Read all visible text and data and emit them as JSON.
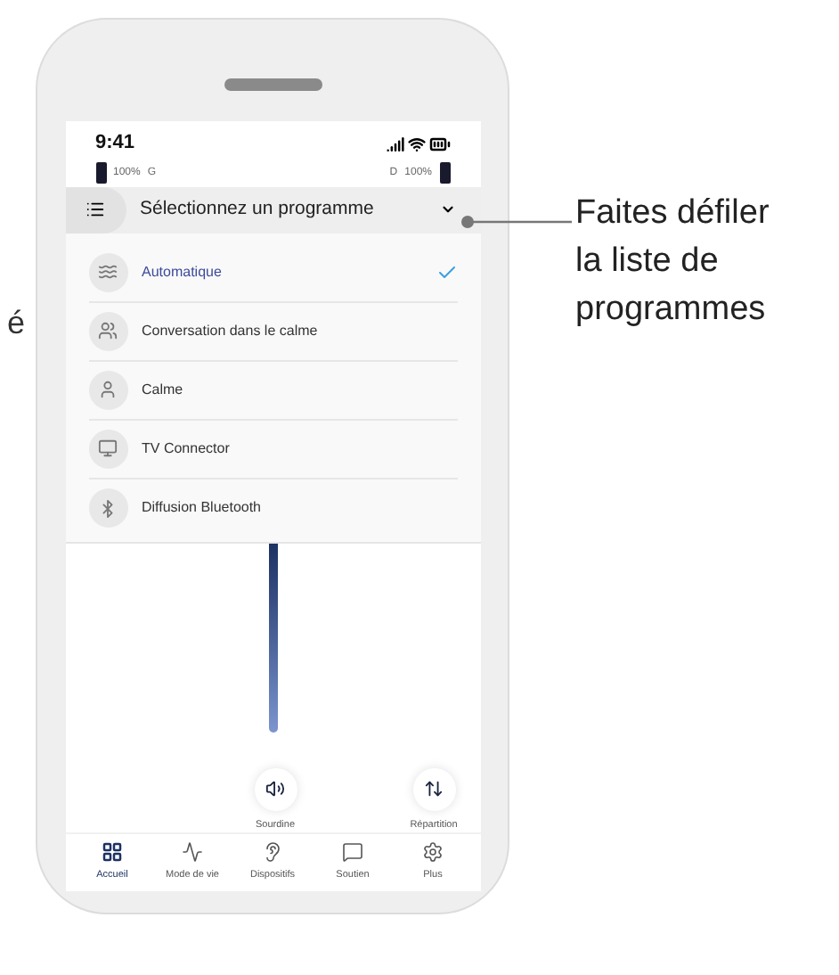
{
  "edge_text": "é",
  "status_bar": {
    "time": "9:41"
  },
  "batteries": {
    "left": {
      "percent": "100%",
      "side": "G"
    },
    "right": {
      "side": "D",
      "percent": "100%"
    }
  },
  "program_selector": {
    "title": "Sélectionnez un programme",
    "expanded": true
  },
  "programs": [
    {
      "label": "Automatique",
      "selected": true,
      "kind": "auto"
    },
    {
      "label": "Conversation dans le calme",
      "selected": false,
      "kind": "conversation"
    },
    {
      "label": "Calme",
      "selected": false,
      "kind": "calm"
    },
    {
      "label": "TV Connector",
      "selected": false,
      "kind": "tv"
    },
    {
      "label": "Diffusion Bluetooth",
      "selected": false,
      "kind": "bluetooth"
    }
  ],
  "actions": [
    {
      "label": "Sourdine",
      "kind": "mute"
    },
    {
      "label": "Répartition",
      "kind": "balance"
    }
  ],
  "nav": [
    {
      "label": "Accueil",
      "selected": true,
      "kind": "home"
    },
    {
      "label": "Mode de vie",
      "selected": false,
      "kind": "activity"
    },
    {
      "label": "Dispositifs",
      "selected": false,
      "kind": "devices"
    },
    {
      "label": "Soutien",
      "selected": false,
      "kind": "support"
    },
    {
      "label": "Plus",
      "selected": false,
      "kind": "more"
    }
  ],
  "callout": {
    "lines": [
      "Faites défiler",
      "la liste de",
      "programmes"
    ]
  }
}
